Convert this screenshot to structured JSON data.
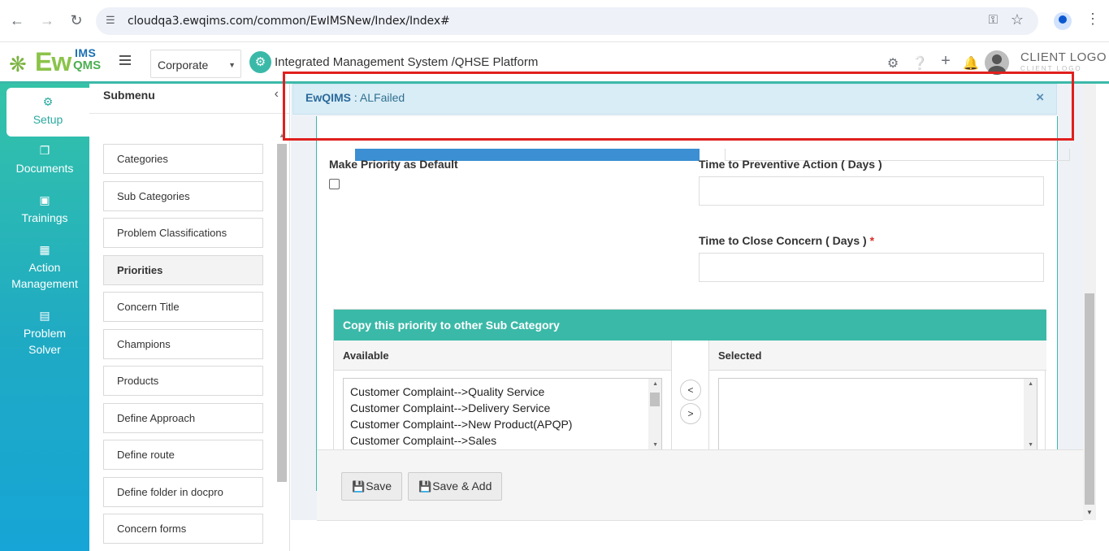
{
  "browser": {
    "url": "cloudqa3.ewqims.com/common/EwIMSNew/Index/Index#"
  },
  "header": {
    "logo_ew": "Ew",
    "logo_ims": "IMS",
    "logo_qms": "QMS",
    "company": "Corporate",
    "platform_title": "Integrated Management System /QHSE Platform",
    "client_logo": "CLIENT LOGO",
    "client_logo_sub": "CLIENT LOGO"
  },
  "sidebar": {
    "items": [
      {
        "label": "Setup",
        "icon": "gears-icon",
        "active": true
      },
      {
        "label": "Documents",
        "icon": "documents-icon"
      },
      {
        "label": "Trainings",
        "icon": "trainings-icon"
      },
      {
        "label": "Action Management",
        "icon": "building-icon"
      },
      {
        "label": "Problem Solver",
        "icon": "problem-solver-icon"
      }
    ]
  },
  "submenu": {
    "title": "Submenu",
    "items": [
      {
        "label": "Categories"
      },
      {
        "label": "Sub Categories"
      },
      {
        "label": "Problem Classifications"
      },
      {
        "label": "Priorities",
        "active": true
      },
      {
        "label": "Concern Title"
      },
      {
        "label": "Champions"
      },
      {
        "label": "Products"
      },
      {
        "label": "Define Approach"
      },
      {
        "label": "Define route"
      },
      {
        "label": "Define folder in docpro"
      },
      {
        "label": "Concern forms"
      }
    ]
  },
  "alert": {
    "brand": "EwQIMS",
    "separator": " : ",
    "message": "ALFailed",
    "close": "×"
  },
  "form": {
    "make_priority_default_label": "Make Priority as Default",
    "make_priority_default_checked": false,
    "preventive_action_label": "Time to Preventive Action ( Days )",
    "preventive_action_value": "",
    "close_concern_label": "Time to Close Concern ( Days )",
    "close_concern_required": "*",
    "close_concern_value": ""
  },
  "copy_panel": {
    "title": "Copy this priority to other Sub Category",
    "available_label": "Available",
    "selected_label": "Selected",
    "available_options": [
      "Customer Complaint-->Quality Service",
      "Customer Complaint-->Delivery Service",
      "Customer Complaint-->New Product(APQP)",
      "Customer Complaint-->Sales"
    ],
    "selected_options": [],
    "move_left": "<",
    "move_right": ">"
  },
  "footer": {
    "save_label": "Save",
    "save_add_label": "Save & Add"
  },
  "colors": {
    "accent": "#3bb9a8",
    "alert_bg": "#d9edf7",
    "highlight": "#e0201e",
    "primary_bar": "#3b8fd2"
  }
}
